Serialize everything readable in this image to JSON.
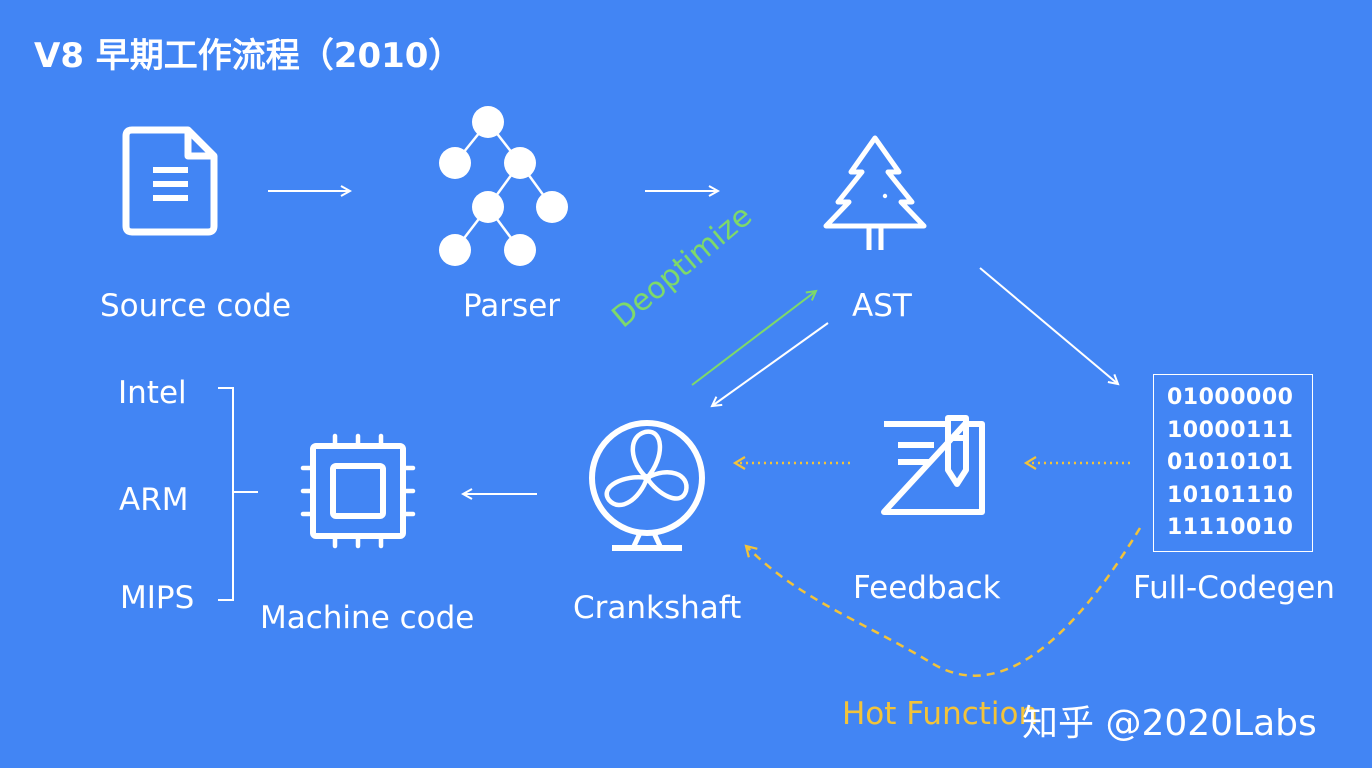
{
  "title": "V8 早期工作流程（2010）",
  "nodes": {
    "source_code": "Source code",
    "parser": "Parser",
    "ast": "AST",
    "full_codegen": "Full-Codegen",
    "feedback": "Feedback",
    "crankshaft": "Crankshaft",
    "machine_code": "Machine code"
  },
  "architectures": [
    "Intel",
    "ARM",
    "MIPS"
  ],
  "binary_lines": [
    "01000000",
    "10000111",
    "01010101",
    "10101110",
    "11110010"
  ],
  "edge_labels": {
    "deoptimize": "Deoptimize",
    "hot_function": "Hot Function"
  },
  "watermark": "知乎 @2020Labs",
  "colors": {
    "background": "#4285f4",
    "foreground": "#ffffff",
    "deoptimize": "#7ed96a",
    "hot_path": "#f2c33a"
  },
  "icons": [
    "document-icon",
    "node-graph-icon",
    "tree-icon",
    "binary-block-icon",
    "notebook-pen-icon",
    "fan-icon",
    "chip-icon"
  ]
}
